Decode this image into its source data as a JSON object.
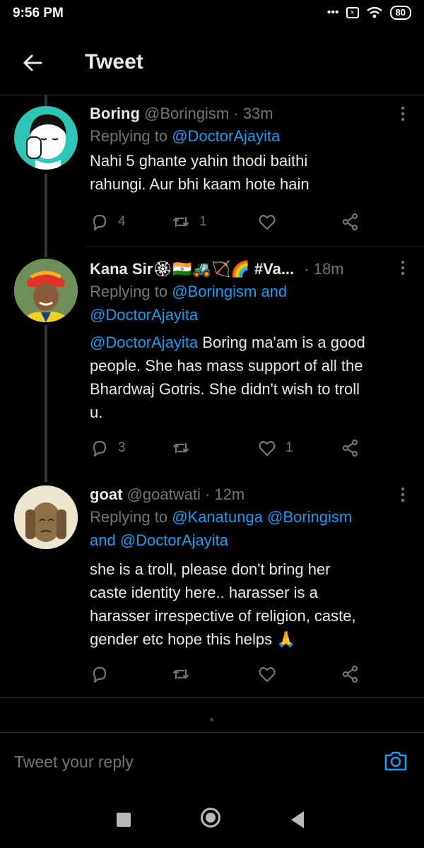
{
  "status_bar": {
    "time": "9:56 PM",
    "dots": "•••",
    "battery": "80"
  },
  "header": {
    "title": "Tweet"
  },
  "tweets": [
    {
      "name": "Boring",
      "handle": "@Boringism",
      "time": "· 33m",
      "replying_prefix": "Replying to ",
      "replying_users": "@DoctorAjayita",
      "text_lines": [
        "Nahi 5 ghante yahin thodi baithi",
        "rahungi. Aur bhi kaam hote hain"
      ],
      "reply_count": "4",
      "retweet_count": "1",
      "like_count": ""
    },
    {
      "name": "Kana Sir",
      "name_emoji": "🏵🇮🇳🚜🏹🌈",
      "hashtag": "#Va...",
      "time": "· 18m",
      "replying_prefix": "Replying to ",
      "replying_users_1": "@Boringism and",
      "replying_users_2": "@DoctorAjayita",
      "text_mention": "@DoctorAjayita",
      "text_line_1_rest": " Boring ma'am is a good",
      "text_lines": [
        "people. She has mass support of all the",
        "Bhardwaj Gotris. She didn't wish to troll",
        "u."
      ],
      "reply_count": "3",
      "retweet_count": "",
      "like_count": "1"
    },
    {
      "name": "goat",
      "handle": "@goatwati",
      "time": "· 12m",
      "replying_prefix": "Replying to ",
      "replying_users_1": "@Kanatunga @Boringism",
      "replying_users_2": "and @DoctorAjayita",
      "text_lines": [
        "she is a troll, please don't bring her",
        "caste identity here.. harasser is a",
        "harasser irrespective of religion, caste,",
        "gender etc hope this helps 🙏"
      ],
      "reply_count": "",
      "retweet_count": "",
      "like_count": ""
    }
  ],
  "reply_bar": {
    "placeholder": "Tweet your reply"
  },
  "icons": {
    "back": "arrow-left-icon",
    "more": "more-vertical-icon",
    "reply": "reply-icon",
    "retweet": "retweet-icon",
    "like": "heart-icon",
    "share": "share-icon",
    "camera": "camera-icon"
  },
  "colors": {
    "background": "#000000",
    "text": "#e7e9ea",
    "muted": "#71767b",
    "link": "#1d9bf0"
  }
}
